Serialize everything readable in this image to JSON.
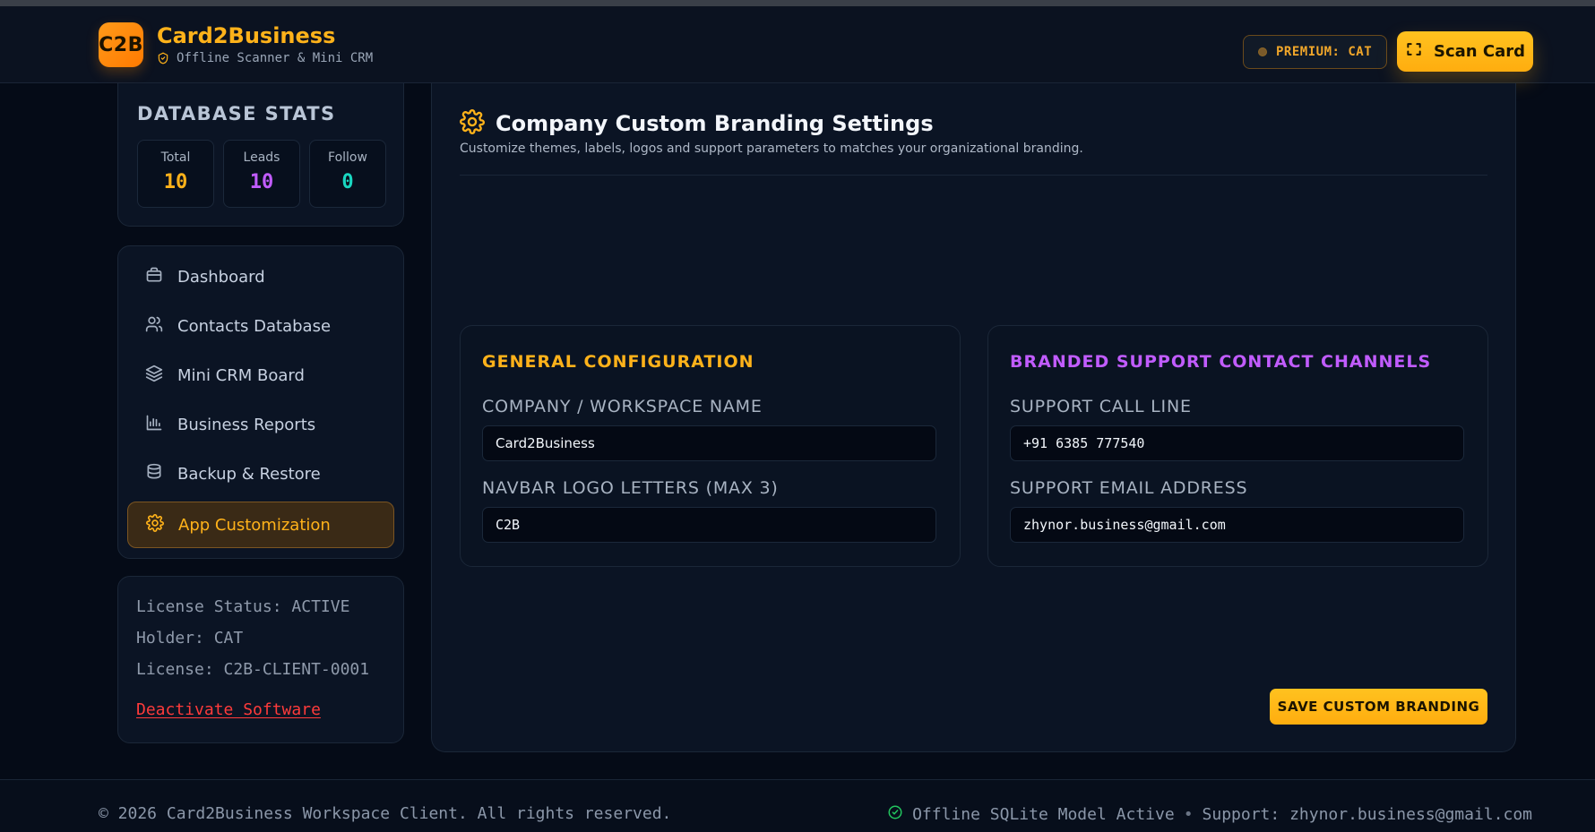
{
  "colors": {
    "accent": "#ffb21a",
    "purple": "#c15cff",
    "teal": "#19d6c0",
    "danger": "#ff4d4d",
    "background": "#050b17"
  },
  "header": {
    "logo_text": "C2B",
    "app_name": "Card2Business",
    "subtitle": "Offline Scanner & Mini CRM",
    "premium_badge": "PREMIUM: CAT",
    "scan_button": "Scan Card",
    "icons": {
      "subtitle_icon": "shield-check-icon",
      "scan_icon": "scan-frame-icon"
    }
  },
  "sidebar": {
    "stats": {
      "title": "DATABASE STATS",
      "total_label": "Total",
      "total_value": "10",
      "leads_label": "Leads",
      "leads_value": "10",
      "follow_label": "Follow",
      "follow_value": "0"
    },
    "nav": [
      {
        "label": "Dashboard",
        "icon": "briefcase-icon",
        "active": false
      },
      {
        "label": "Contacts Database",
        "icon": "users-icon",
        "active": false
      },
      {
        "label": "Mini CRM Board",
        "icon": "layers-icon",
        "active": false
      },
      {
        "label": "Business Reports",
        "icon": "bar-chart-icon",
        "active": false
      },
      {
        "label": "Backup & Restore",
        "icon": "database-icon",
        "active": false
      },
      {
        "label": "App Customization",
        "icon": "gear-icon",
        "active": true
      }
    ],
    "license": {
      "status": "License Status: ACTIVE",
      "holder": "Holder: CAT",
      "license": "License: C2B-CLIENT-0001",
      "deactivate": "Deactivate Software"
    }
  },
  "main": {
    "title": "Company Custom Branding Settings",
    "subtitle": "Customize themes, labels, logos and support parameters to matches your organizational branding.",
    "general": {
      "title": "GENERAL CONFIGURATION",
      "company_label": "COMPANY / WORKSPACE NAME",
      "company_value": "Card2Business",
      "logo_label": "NAVBAR LOGO LETTERS (MAX 3)",
      "logo_value": "C2B"
    },
    "support": {
      "title": "BRANDED SUPPORT CONTACT CHANNELS",
      "call_label": "SUPPORT CALL LINE",
      "call_value": "+91 6385 777540",
      "email_label": "SUPPORT EMAIL ADDRESS",
      "email_value": "zhynor.business@gmail.com"
    },
    "save_button": "SAVE CUSTOM BRANDING"
  },
  "footer": {
    "copyright": "© 2026 Card2Business Workspace Client. All rights reserved.",
    "status": "Offline SQLite Model Active",
    "separator": "•",
    "support": "Support: zhynor.business@gmail.com"
  }
}
